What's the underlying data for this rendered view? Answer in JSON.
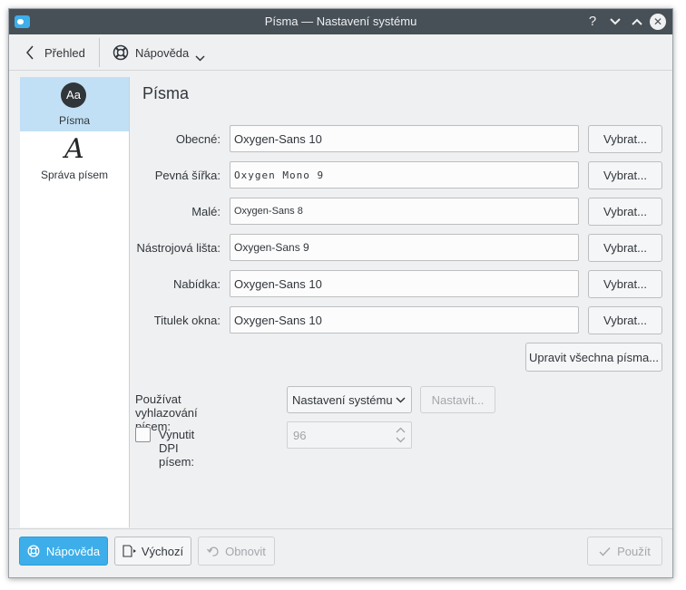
{
  "window": {
    "title": "Písma  — Nastavení systému",
    "controls": [
      "help-icon",
      "minimize-icon",
      "maximize-icon",
      "close-icon"
    ]
  },
  "toolbar": {
    "back_label": "Přehled",
    "help_label": "Nápověda"
  },
  "sidebar": {
    "items": [
      {
        "label": "Písma",
        "icon": "fonts-icon",
        "selected": true
      },
      {
        "label": "Správa písem",
        "icon": "font-management-icon",
        "selected": false
      }
    ]
  },
  "main": {
    "heading": "Písma",
    "fonts": [
      {
        "label": "Obecné:",
        "value": "Oxygen-Sans 10",
        "button": "Vybrat..."
      },
      {
        "label": "Pevná šířka:",
        "value": "Oxygen Mono 9",
        "button": "Vybrat..."
      },
      {
        "label": "Malé:",
        "value": "Oxygen-Sans 8",
        "button": "Vybrat..."
      },
      {
        "label": "Nástrojová lišta:",
        "value": "Oxygen-Sans 9",
        "button": "Vybrat..."
      },
      {
        "label": "Nabídka:",
        "value": "Oxygen-Sans 10",
        "button": "Vybrat..."
      },
      {
        "label": "Titulek okna:",
        "value": "Oxygen-Sans 10",
        "button": "Vybrat..."
      }
    ],
    "adjust_all_button": "Upravit všechna písma...",
    "antialias": {
      "label": "Používat vyhlazování písem:",
      "selected": "Nastavení systému",
      "configure_button": "Nastavit..."
    },
    "dpi": {
      "label": "Vynutit DPI písem:",
      "checked": false,
      "value": "96"
    }
  },
  "footer": {
    "help_button": "Nápověda",
    "defaults_button": "Výchozí",
    "reset_button": "Obnovit",
    "apply_button": "Použít"
  },
  "colors": {
    "accent": "#3daee9",
    "titlebar": "#475057",
    "selection": "#c2e0f5",
    "window_bg": "#eff0f1"
  }
}
